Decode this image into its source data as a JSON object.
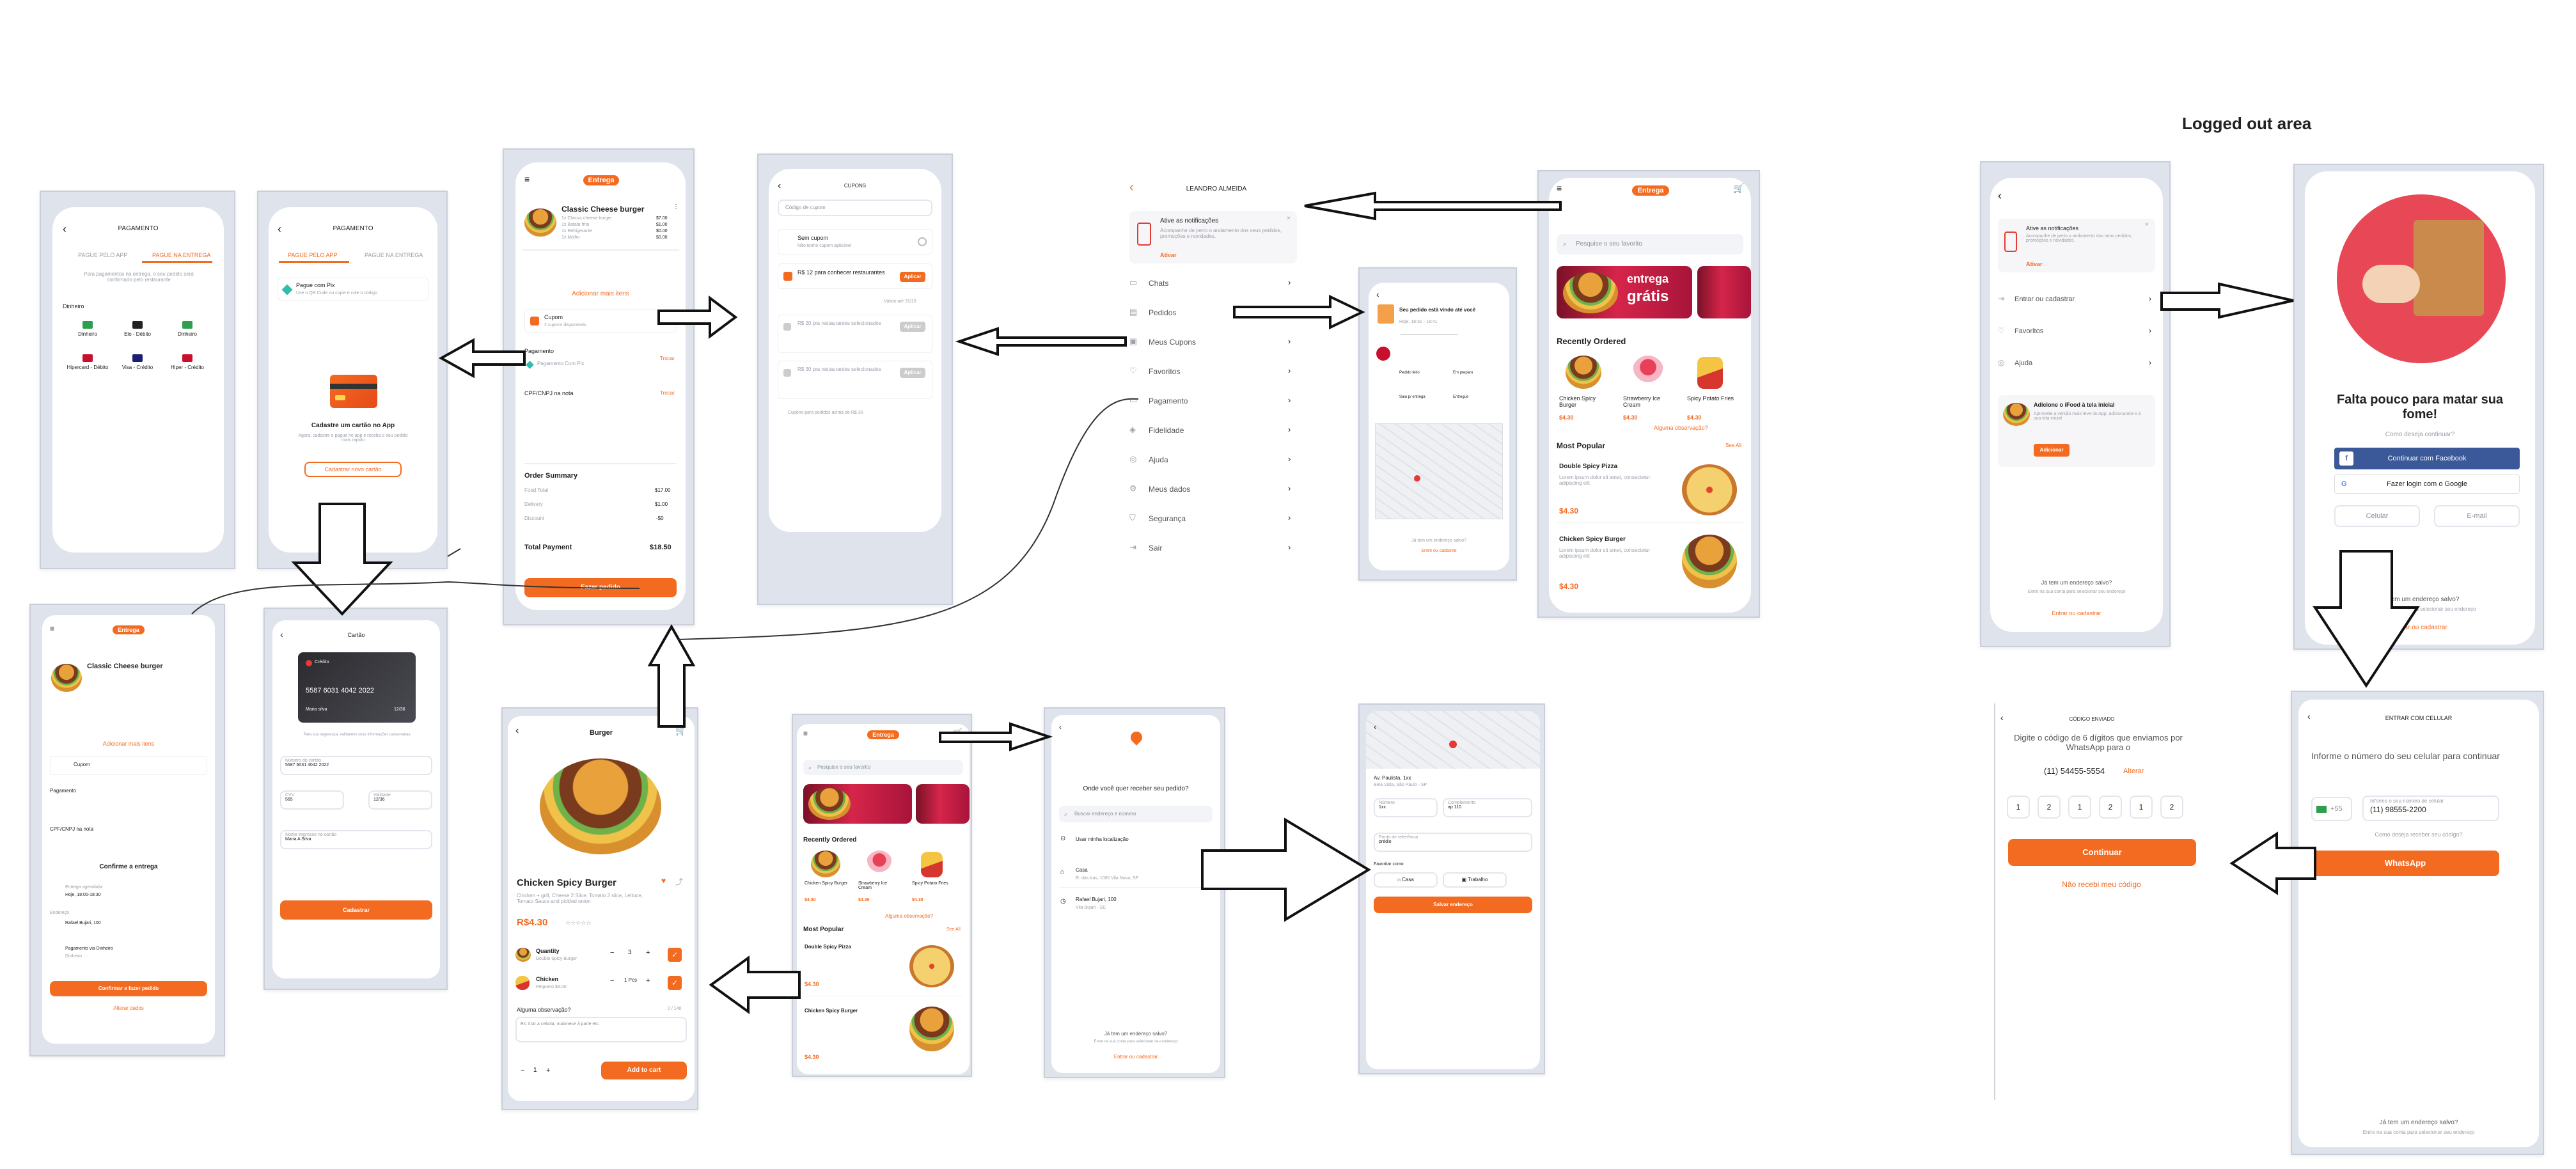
{
  "logged_out": {
    "title": "Logged out area"
  },
  "pay_delivery": {
    "title": "PAGAMENTO",
    "tab_app": "PAGUE PELO APP",
    "tab_delivery": "PAGUE NA ENTREGA",
    "note": "Para pagamentos na entrega, o seu pedido será confirmado pelo restaurante",
    "section": "Dinheiro",
    "options": [
      "Dinheiro",
      "Elo - Débito",
      "Dinheiro",
      "Hipercard - Débito",
      "Visa - Crédito",
      "Hiper - Crédito"
    ]
  },
  "pay_app": {
    "title": "PAGAMENTO",
    "tab_app": "PAGUE PELO APP",
    "tab_delivery": "PAGUE NA ENTREGA",
    "pix_title": "Pague com Pix",
    "pix_sub": "Use o QR Code ou copie e cole o código",
    "empty_title": "Cadastre um cartão no App",
    "empty_sub": "Agora, cadastre e pague no app e receba o seu pedido mais rápido",
    "button": "Cadastrar novo cartão"
  },
  "cart": {
    "tag": "Entrega",
    "item_name": "Classic Cheese burger",
    "item_lines": [
      "1x Classic cheese burger",
      "1x Batata frita",
      "1x Refrigerante",
      "1x Molho"
    ],
    "item_prices": [
      "$7.00",
      "$1.00",
      "$0.00",
      "$0.00"
    ],
    "add_more": "Adicionar mais itens",
    "coupon": "Cupom",
    "coupon_sub": "2 cupons disponíveis",
    "payment": "Pagamento",
    "payment_method": "Pagamento Com Pix",
    "change": "Trocar",
    "cpf": "CPF/CNPJ na nota",
    "summary_title": "Order Summary",
    "summary": [
      [
        "Food Total",
        "$17.00"
      ],
      [
        "Delivery",
        "$1.00"
      ],
      [
        "Discount",
        "-$0"
      ]
    ],
    "total_label": "Total Payment",
    "total_value": "$18.50",
    "button": "Fazer pedido"
  },
  "coupons": {
    "title": "CUPONS",
    "input": "Código de cupom",
    "none": "Sem cupom",
    "none_sub": "Não tenho cupom aplicável",
    "c1": "R$ 12 para conhecer restaurantes",
    "apply": "Aplicar",
    "c2": "R$ 20 pra restaurantes selecionados",
    "c3": "R$ 30 pra restaurantes selecionados",
    "see": "Válido até 31/10",
    "foot": "Cupons para pedidos acima de R$ 30"
  },
  "menu": {
    "user": "LEANDRO ALMEIDA",
    "notif_title": "Ative as notificações",
    "notif_sub": "Acompanhe de perto o andamento dos seus pedidos, promoções e novidades.",
    "notif_btn": "Ativar",
    "items": [
      "Chats",
      "Pedidos",
      "Meus Cupons",
      "Favoritos",
      "Pagamento",
      "Fidelidade",
      "Ajuda",
      "Meus dados",
      "Segurança",
      "Sair"
    ]
  },
  "home": {
    "tag": "Entrega",
    "search": "Pesquise o seu favorito",
    "banner_small": "entrega",
    "banner_big": "grátis",
    "recent": "Recently Ordered",
    "recent_items": [
      [
        "Chicken Spicy Burger",
        "$4.30"
      ],
      [
        "Strawberry Ice Cream",
        "$4.30"
      ],
      [
        "Spicy Potato Fries",
        "$4.30"
      ]
    ],
    "note": "Alguma observação?",
    "popular": "Most Popular",
    "see_all": "See All",
    "popular_items": [
      [
        "Double Spicy Pizza",
        "Lorem ipsum dolor sit amet, consectetur adipiscing elit",
        "$4.30"
      ],
      [
        "Chicken Spicy Burger",
        "Lorem ipsum dolor sit amet, consectetur adipiscing elit",
        "$4.30"
      ]
    ]
  },
  "tracking": {
    "title": "Seu pedido está vindo até você",
    "eta": "Hoje, 18:31 - 18:41",
    "steps": [
      "Pedido feito",
      "Em preparo",
      "Saiu p/ entrega",
      "Entregue"
    ],
    "foot": "Já tem um endereço salvo?",
    "link": "Entre ou cadastre"
  },
  "out_menu": {
    "notif_title": "Ative as notificações",
    "notif_sub": "Acompanhe de perto o andamento dos seus pedidos, promoções e novidades.",
    "notif_btn": "Ativar",
    "items": [
      "Entrar ou cadastrar",
      "Favoritos",
      "Ajuda"
    ],
    "add_title": "Adicione o iFood à tela inicial",
    "add_sub": "Aproveite a versão mais leve do App, adicionando-o à sua tela inicial",
    "add_btn": "Adicionar",
    "foot": "Já tem um endereço salvo?",
    "foot_sub": "Entre na sua conta para selecionar seu endereço",
    "link": "Entrar ou cadastrar"
  },
  "login": {
    "title": "Falta pouco para matar sua fome!",
    "sub": "Como deseja continuar?",
    "facebook": "Continuar com Facebook",
    "google": "Fazer login com o Google",
    "cel": "Celular",
    "email": "E-mail",
    "foot": "Já tem um endereço salvo?",
    "foot_sub": "Entre na sua conta para selecionar seu endereço",
    "link": "Entrar ou cadastrar"
  },
  "checkout": {
    "tag": "Entrega",
    "item_name": "Classic Cheese burger",
    "add_more": "Adicionar mais itens",
    "coupon": "Cupom",
    "payment": "Pagamento",
    "cpf": "CPF/CNPJ na nota",
    "confirm_title": "Confirme a entrega",
    "delivery_label": "Entrega agendada",
    "delivery_val": "Hoje, 18:00-18:30",
    "address_label": "Endereço",
    "address_val": "Rafael Bujari, 100",
    "pay_label": "Pagamento via Dinheiro",
    "pay_val": "Dinheiro",
    "button": "Confirmar e fazer pedido",
    "back": "Alterar dados"
  },
  "card": {
    "title": "Cartão",
    "brand": "Crédito",
    "number": "5587 6031 4042 2022",
    "holder": "Maria silva",
    "expiry": "12/36",
    "hint": "Para sua segurança, validamos suas informações cadastradas",
    "number_label": "Número do cartão",
    "number_val": "5587 6031 4042 2022",
    "cvv_label": "CVV",
    "cvv_val": "565",
    "exp_label": "Validade",
    "exp_val": "12/36",
    "name_label": "Nome impresso no cartão",
    "name_val": "Maria A Silva",
    "button": "Cadastrar"
  },
  "detail": {
    "title": "Burger",
    "name": "Chicken Spicy Burger",
    "desc": "Chicken + grill, Cheese 2 Slice, Tomato 2 slice, Lettuce, Tomato Sauce and pickled onion",
    "price": "R$4.30",
    "qty_label": "Quantity",
    "qty_sub": "Double Spicy Burger",
    "qty": "3",
    "chicken_label": "Chicken",
    "chicken_sub": "Pequeno $3.00",
    "chicken_qty": "1 Pcs",
    "obs": "Alguma observação?",
    "obs_count": "0 / 140",
    "obs_placeholder": "Ex: tirar a cebola, maionese à parte etc.",
    "count": "1",
    "button": "Add to cart"
  },
  "home2": {
    "tag": "Entrega",
    "search": "Pesquise o seu favorito",
    "recent": "Recently Ordered",
    "recent_items": [
      [
        "Chicken Spicy Burger",
        "$4.30"
      ],
      [
        "Strawberry Ice Cream",
        "$4.30"
      ],
      [
        "Spicy Potato Fries",
        "$4.30"
      ]
    ],
    "note": "Alguma observação?",
    "popular": "Most Popular",
    "see_all": "See All",
    "popular_items": [
      [
        "Double Spicy Pizza",
        "$4.30"
      ],
      [
        "Chicken Spicy Burger",
        "$4.30"
      ]
    ]
  },
  "address": {
    "title": "Onde você quer receber seu pedido?",
    "search": "Buscar endereço e número",
    "current": "Usar minha localização",
    "a1_label": "Casa",
    "a1_sub": "R. das Iras, 1000 Vila Nova, SP",
    "a2_label": "Rafael Bujari, 100",
    "a2_sub": "Vila Bujari - SC",
    "foot": "Já tem um endereço salvo?",
    "foot_sub": "Entre na sua conta para selecionar seu endereço",
    "link": "Entrar ou cadastrar"
  },
  "address_form": {
    "street": "Av. Paulista, 1xx",
    "city": "Bela Vista, São Paulo - SP",
    "number_label": "Número",
    "number_val": "1xx",
    "comp_label": "Complemento",
    "comp_val": "ap 110",
    "ref_label": "Ponto de referência",
    "ref_val": "prédio",
    "fav_label": "Favoritar como",
    "fav1": "Casa",
    "fav2": "Trabalho",
    "button": "Salvar endereço"
  },
  "code": {
    "title": "CÓDIGO ENVIADO",
    "instr": "Digite o código de 6 dígitos que enviamos por WhatsApp para o",
    "phone": "(11) 54455-5554",
    "change": "Alterar",
    "digits": [
      "1",
      "2",
      "1",
      "2",
      "1",
      "2"
    ],
    "button": "Continuar",
    "resend": "Não recebi meu código"
  },
  "phone": {
    "title": "ENTRAR COM CELULAR",
    "instr": "Informe o número do seu celular para continuar",
    "ddi": "+55",
    "label": "Informe o seu número de celular",
    "value": "(11) 98555-2200",
    "how": "Como deseja receber seu código?",
    "button": "WhatsApp",
    "foot": "Já tem um endereço salvo?",
    "foot_sub": "Entre na sua conta para selecionar seu endereço"
  },
  "colors": {
    "accent": "#f36b21",
    "frame": "#dfe3ec",
    "facebook": "#3b5998"
  }
}
